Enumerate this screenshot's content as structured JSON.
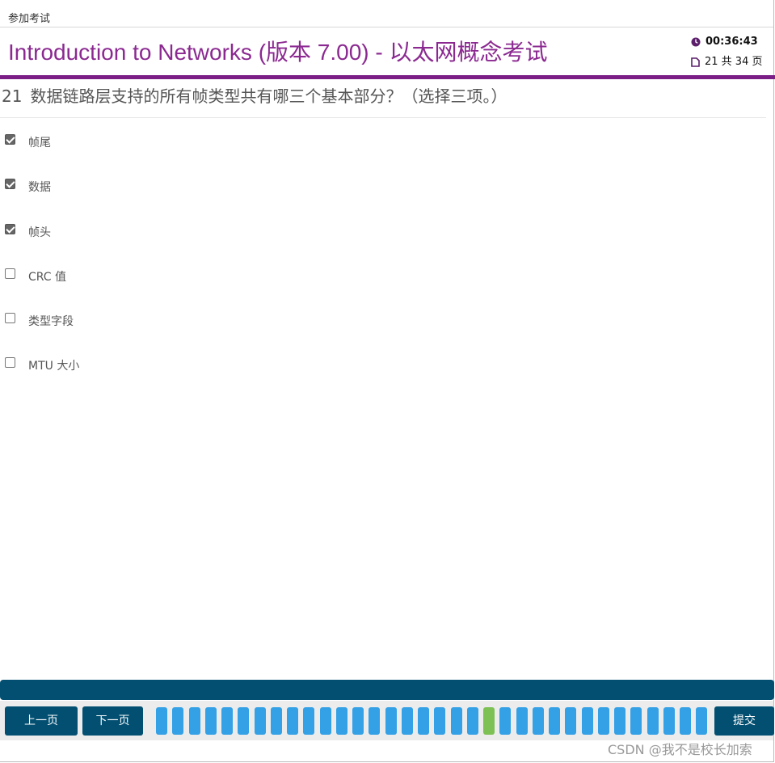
{
  "topbar": {
    "label": "参加考试"
  },
  "header": {
    "title": "Introduction to Networks (版本 7.00) - 以太网概念考试",
    "timer": "00:36:43",
    "page_info": "21 共 34 页"
  },
  "question": {
    "number": "21",
    "text": "数据链路层支持的所有帧类型共有哪三个基本部分？（选择三项。）",
    "options": [
      {
        "label": "帧尾",
        "checked": true
      },
      {
        "label": "数据",
        "checked": true
      },
      {
        "label": "帧头",
        "checked": true
      },
      {
        "label": "CRC 值",
        "checked": false
      },
      {
        "label": "类型字段",
        "checked": false
      },
      {
        "label": "MTU 大小",
        "checked": false
      }
    ]
  },
  "nav": {
    "prev_label": "上一页",
    "next_label": "下一页",
    "submit_label": "提交",
    "total_questions": 34,
    "current_question": 21
  },
  "colors": {
    "brand_purple": "#7b1f86",
    "nav_blue": "#024f71",
    "question_button": "#34a1e6",
    "current_button": "#7dc053"
  },
  "watermark": "CSDN @我不是校长加索"
}
